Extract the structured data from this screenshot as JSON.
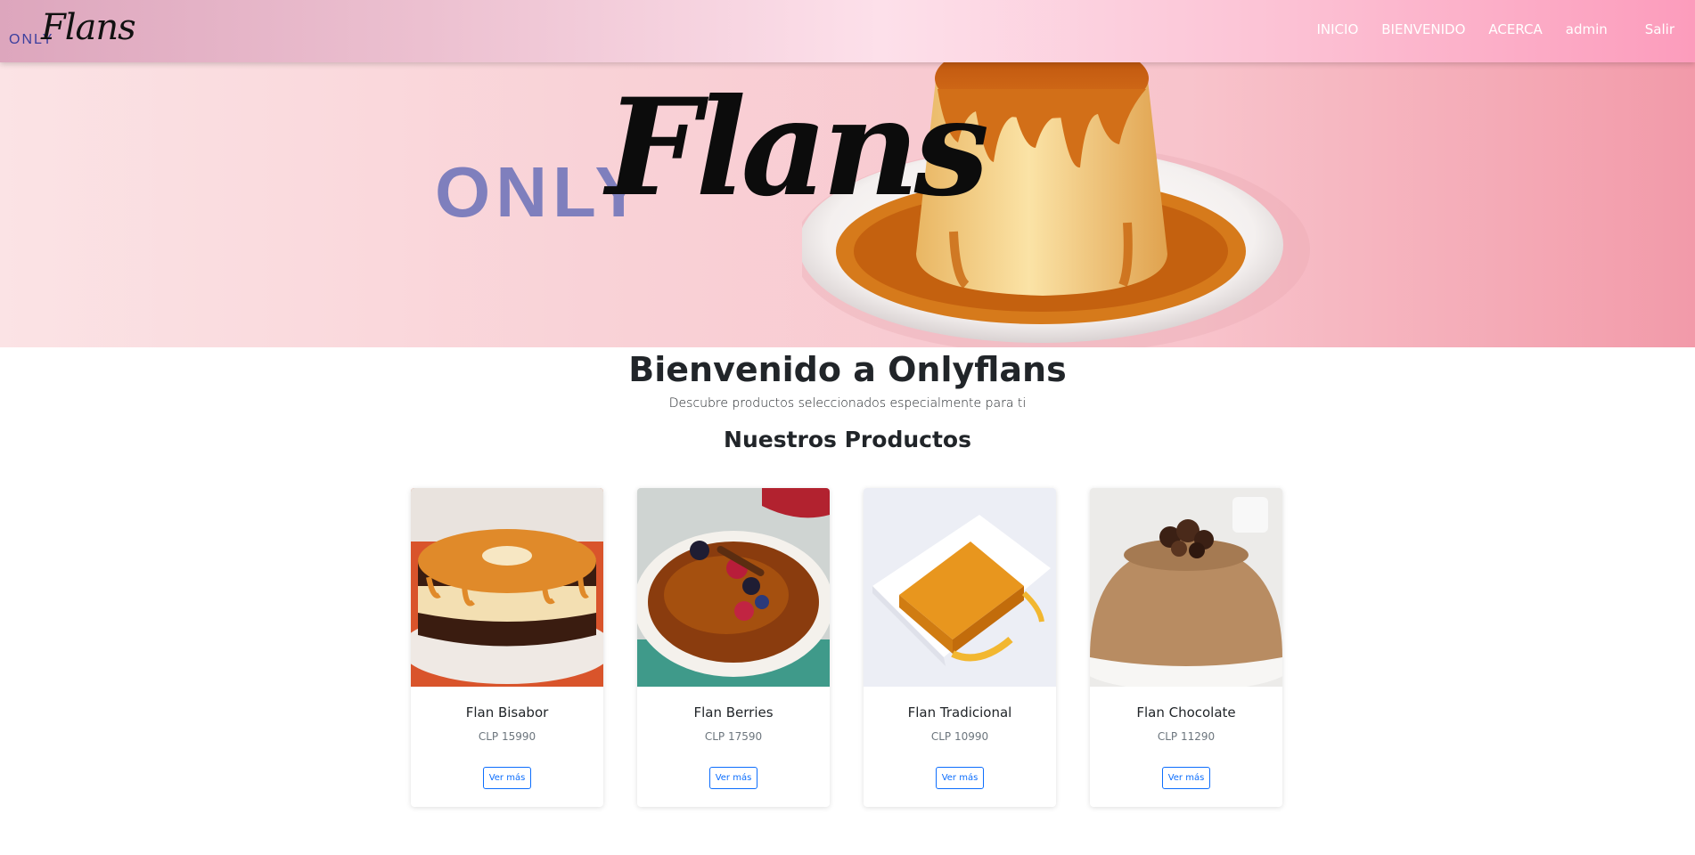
{
  "navbar": {
    "brand_only": "ONLY",
    "brand_flans": "Flans",
    "links": [
      "INICIO",
      "BIENVENIDO",
      "ACERCA"
    ],
    "user": "admin",
    "logout": "Salir"
  },
  "hero": {
    "only": "ONLY",
    "flans": "Flans"
  },
  "main": {
    "welcome_title": "Bienvenido a Onlyflans",
    "subtitle": "Descubre productos seleccionados especialmente para ti",
    "section_title": "Nuestros Productos"
  },
  "products": [
    {
      "name": "Flan Bisabor",
      "price": "CLP 15990",
      "button": "Ver más"
    },
    {
      "name": "Flan Berries",
      "price": "CLP 17590",
      "button": "Ver más"
    },
    {
      "name": "Flan Tradicional",
      "price": "CLP 10990",
      "button": "Ver más"
    },
    {
      "name": "Flan Chocolate",
      "price": "CLP 11290",
      "button": "Ver más"
    }
  ],
  "colors": {
    "accent_blue": "#0d6efd",
    "caramel": "#c8650f",
    "flan_cream": "#f4cf85",
    "hero_pink": "#f8c4cc",
    "brand_purple": "#7f7fbd"
  }
}
